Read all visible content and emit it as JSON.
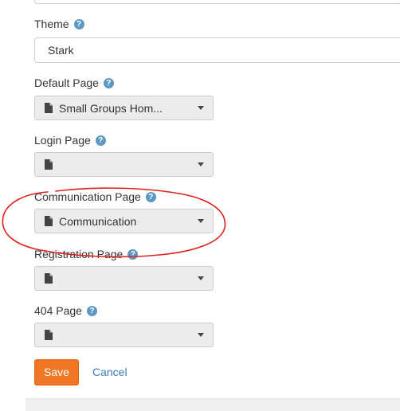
{
  "form": {
    "theme": {
      "label": "Theme",
      "value": "Stark"
    },
    "default_page": {
      "label": "Default Page",
      "value": "Small Groups Hom..."
    },
    "login_page": {
      "label": "Login Page",
      "value": ""
    },
    "communication_page": {
      "label": "Communication Page",
      "value": "Communication"
    },
    "registration_page": {
      "label": "Registration Page",
      "value": ""
    },
    "not_found_page": {
      "label": "404 Page",
      "value": ""
    }
  },
  "actions": {
    "save_label": "Save",
    "cancel_label": "Cancel"
  },
  "icons": {
    "help": "help-circle-icon",
    "file": "file-icon",
    "caret": "caret-down-icon"
  },
  "colors": {
    "accent": "#ee7624",
    "link": "#3c7bb3",
    "help_icon": "#5d98c3",
    "annotation": "#e0201b"
  }
}
